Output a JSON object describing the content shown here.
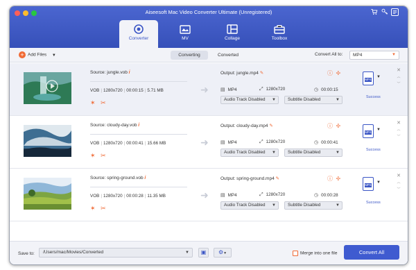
{
  "window": {
    "title": "Aiseesoft Mac Video Converter Ultimate (Unregistered)",
    "traffic_colors": [
      "#ff5f57",
      "#febc2e",
      "#28c840"
    ]
  },
  "colors": {
    "accent": "#3a55c5",
    "orange": "#f06a35",
    "topbar": "#3f5bd0"
  },
  "header_icons": [
    "cart-icon",
    "key-icon",
    "chat-icon"
  ],
  "tabs": [
    {
      "label": "Converter",
      "icon": "converter-icon",
      "active": true
    },
    {
      "label": "MV",
      "icon": "mv-icon",
      "active": false
    },
    {
      "label": "Collage",
      "icon": "collage-icon",
      "active": false
    },
    {
      "label": "Toolbox",
      "icon": "toolbox-icon",
      "active": false
    }
  ],
  "toolbar": {
    "add_files": "Add Files",
    "seg_converting": "Converting",
    "seg_converted": "Converted",
    "convert_all_to": "Convert All to:",
    "format": "MP4"
  },
  "files": [
    {
      "source": "Source: jungle.vob",
      "format": "VOB",
      "resolution": "1280x720",
      "duration": "00:00:15",
      "size": "5.71 MB",
      "output": "Output: jungle.mp4",
      "out_format": "MP4",
      "out_resolution": "1280x720",
      "out_duration": "00:00:15",
      "audio": "Audio Track Disabled",
      "subtitle": "Subtitle Disabled",
      "badge": "MP4",
      "status": "Success",
      "selected": true,
      "thumb": "jungle"
    },
    {
      "source": "Source: cloudy-day.vob",
      "format": "VOB",
      "resolution": "1280x720",
      "duration": "00:00:41",
      "size": "15.66 MB",
      "output": "Output: cloudy-day.mp4",
      "out_format": "MP4",
      "out_resolution": "1280x720",
      "out_duration": "00:00:41",
      "audio": "Audio Track Disabled",
      "subtitle": "Subtitle Disabled",
      "badge": "MP4",
      "status": "Success",
      "selected": false,
      "thumb": "sky"
    },
    {
      "source": "Source: spring-ground.vob",
      "format": "VOB",
      "resolution": "1280x720",
      "duration": "00:00:28",
      "size": "11.35 MB",
      "output": "Output: spring-ground.mp4",
      "out_format": "MP4",
      "out_resolution": "1280x720",
      "out_duration": "00:00:28",
      "audio": "Audio Track Disabled",
      "subtitle": "Subtitle Disabled",
      "badge": "MP4",
      "status": "Success",
      "selected": false,
      "thumb": "field"
    }
  ],
  "bottom": {
    "save_to": "Save to:",
    "path": "/Users/mac/Movies/Converted",
    "merge": "Merge into one file",
    "convert_all": "Convert All"
  }
}
